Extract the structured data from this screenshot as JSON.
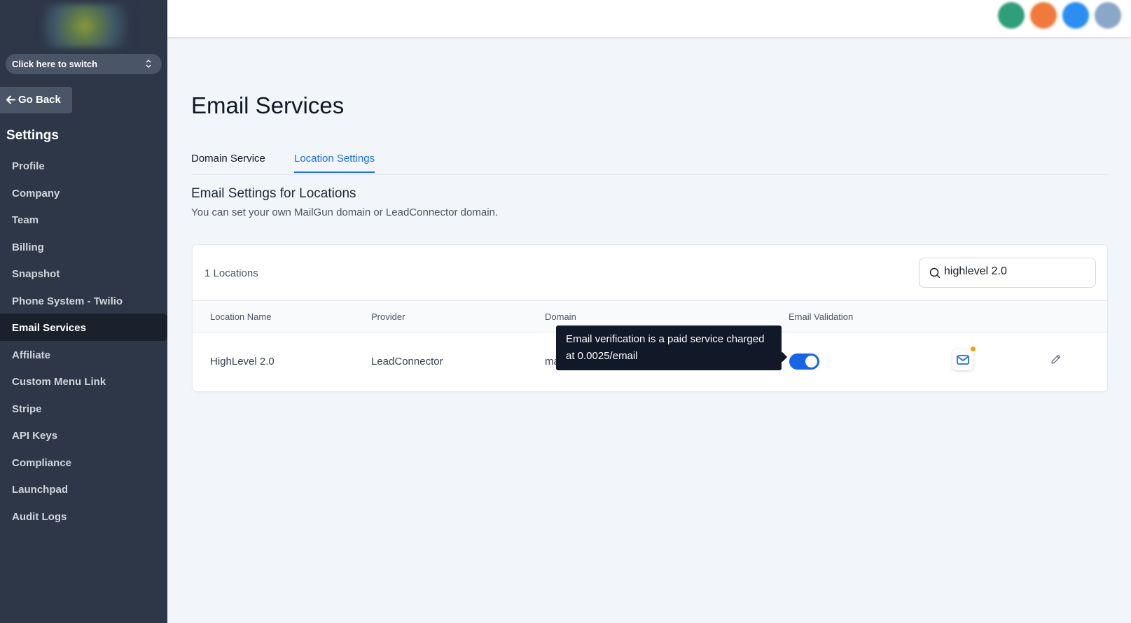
{
  "sidebar": {
    "switcher_label": "Click here to switch",
    "go_back": "Go Back",
    "settings_title": "Settings",
    "items": [
      {
        "label": "Profile"
      },
      {
        "label": "Company"
      },
      {
        "label": "Team"
      },
      {
        "label": "Billing"
      },
      {
        "label": "Snapshot"
      },
      {
        "label": "Phone System - Twilio"
      },
      {
        "label": "Email Services",
        "active": true
      },
      {
        "label": "Affiliate"
      },
      {
        "label": "Custom Menu Link"
      },
      {
        "label": "Stripe"
      },
      {
        "label": "API Keys"
      },
      {
        "label": "Compliance"
      },
      {
        "label": "Launchpad"
      },
      {
        "label": "Audit Logs"
      }
    ]
  },
  "topbar": {
    "avatar_colors": [
      "#2f9e7a",
      "#f07a3c",
      "#2b8ef0",
      "#8aa6c8"
    ]
  },
  "main": {
    "title": "Email Services",
    "tabs": [
      {
        "label": "Domain Service",
        "active": false
      },
      {
        "label": "Location Settings",
        "active": true
      }
    ],
    "section_title": "Email Settings for Locations",
    "section_subtitle": "You can set your own MailGun domain or LeadConnector domain.",
    "table": {
      "count_label": "1 Locations",
      "search_value": "highlevel 2.0",
      "headers": [
        "Location Name",
        "Provider",
        "Domain",
        "Email Validation"
      ],
      "rows": [
        {
          "location_name": "HighLevel 2.0",
          "provider": "LeadConnector",
          "domain_partial": "ma",
          "email_validation": true
        }
      ]
    },
    "tooltip": "Email verification is a paid service charged at 0.0025/email"
  },
  "colors": {
    "sidebar_bg": "#2d3748",
    "accent": "#1d6fe8",
    "toggle_on": "#1565e6"
  }
}
